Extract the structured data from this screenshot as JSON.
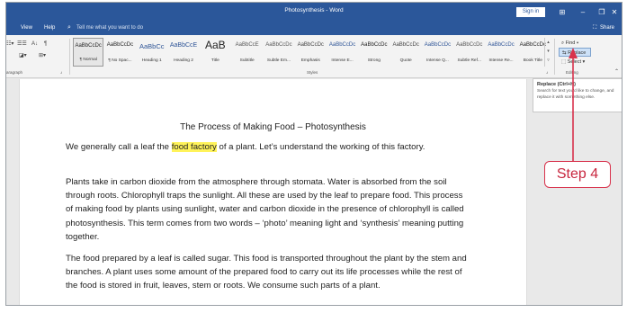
{
  "window": {
    "title": "Photosynthesis - Word",
    "sign_in": "Sign in",
    "ribbon_display_icon": "ribbon-display-options-icon",
    "minimize_icon": "minimize-icon",
    "maximize_icon": "maximize-icon",
    "close_icon": "close-icon",
    "glyphs": {
      "ribbon": "⊞",
      "min": "–",
      "max": "❐",
      "close": "✕"
    }
  },
  "tabs": {
    "view": "View",
    "help": "Help",
    "tell_me_placeholder": "Tell me what you want to do",
    "share": "Share",
    "glyphs": {
      "search": "⌕",
      "share": "⛶"
    }
  },
  "ribbon": {
    "paragraph_group_label": "aragraph",
    "styles_group_label": "Styles",
    "editing_group_label": "Editing",
    "paragraph_glyphs": {
      "bullets": "☷▾",
      "indent": "☰☰",
      "sort": "A↓",
      "pilcrow": "¶",
      "shading": "◪▾",
      "border": "⊞▾",
      "launcher": "⌟"
    },
    "styles": [
      {
        "sample": "AaBbCcDc",
        "name": "¶ Normal",
        "selected": true
      },
      {
        "sample": "AaBbCcDc",
        "name": "¶ No Spac..."
      },
      {
        "sample": "AaBbCc",
        "name": "Heading 1"
      },
      {
        "sample": "AaBbCcE",
        "name": "Heading 2"
      },
      {
        "sample": "AaB",
        "name": "Title"
      },
      {
        "sample": "AaBbCcE",
        "name": "Subtitle"
      },
      {
        "sample": "AaBbCcDc",
        "name": "Subtle Em..."
      },
      {
        "sample": "AaBbCcDc",
        "name": "Emphasis"
      },
      {
        "sample": "AaBbCcDc",
        "name": "Intense E..."
      },
      {
        "sample": "AaBbCcDc",
        "name": "Strong"
      },
      {
        "sample": "AaBbCcDc",
        "name": "Quote"
      },
      {
        "sample": "AaBbCcDc",
        "name": "Intense Q..."
      },
      {
        "sample": "AaBbCcDc",
        "name": "Subtle Ref..."
      },
      {
        "sample": "AaBbCcDc",
        "name": "Intense Re..."
      },
      {
        "sample": "AaBbCcDc",
        "name": "Book Title"
      }
    ],
    "editing": {
      "find": "⌕ Find ▾",
      "replace": "⇆ Replace",
      "select": "⬚ Select ▾"
    },
    "gallery_scroll_glyphs": "▴\n▾\n▿",
    "collapse_glyph": "⌃"
  },
  "tooltip": {
    "title": "Replace (Ctrl+H)",
    "description": "Search for text you'd like to change, and replace it with something else."
  },
  "document": {
    "heading": "The Process of Making Food – Photosynthesis",
    "para1_before": "We generally call a leaf the ",
    "para1_highlight": "food factory",
    "para1_after": " of a plant. Let’s understand the working of this factory.",
    "para2": "Plants take in carbon dioxide from the atmosphere through stomata. Water is absorbed from the soil through roots. Chlorophyll traps the sunlight. All these are used by the leaf to prepare food. This process of making food by plants using sunlight, water and carbon dioxide in the presence of chlorophyll is called photosynthesis. This term comes from two words – ‘photo’ meaning light and ‘synthesis’ meaning putting together.",
    "para3": "The food prepared by a leaf is called sugar. This food is transported throughout the plant by the stem and branches. A plant uses some amount of the prepared food to carry out its life processes while the rest of the food is stored in fruit, leaves, stem or roots. We consume such parts of a plant."
  },
  "callout": {
    "label": "Step 4",
    "color": "#d8324c"
  },
  "colors": {
    "title_bar": "#2b579a",
    "highlight": "#fff35a"
  }
}
